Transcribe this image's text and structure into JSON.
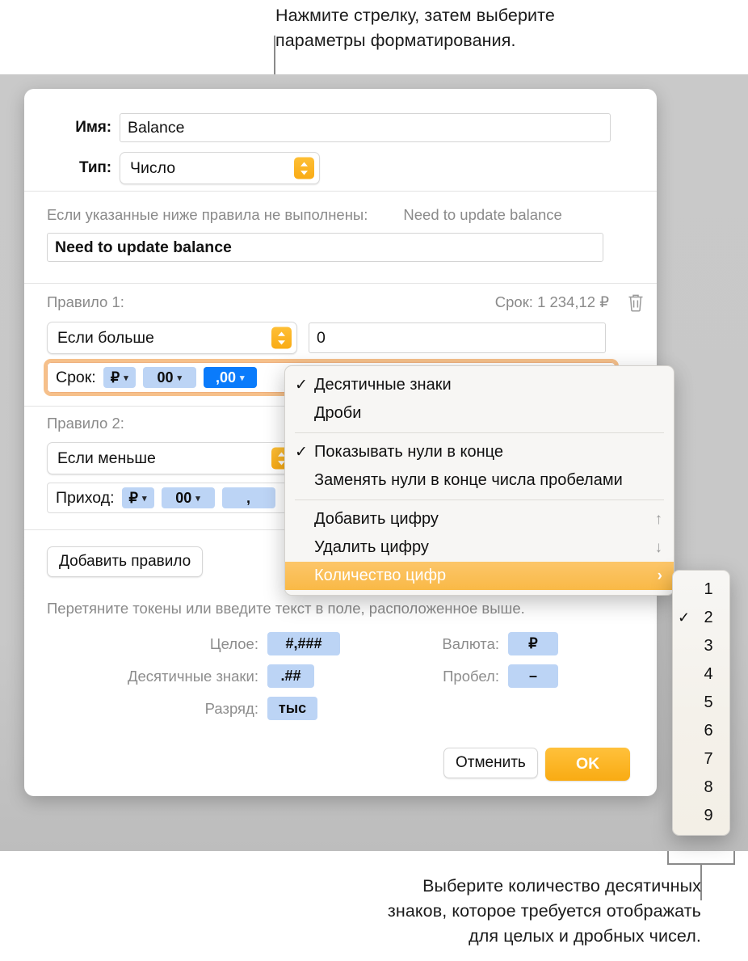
{
  "captions": {
    "top": "Нажмите стрелку, затем выберите\nпараметры форматирования.",
    "bottom": "Выберите количество десятичных\nзнаков, которое требуется отображать\nдля целых и дробных чисел."
  },
  "dialog": {
    "name_label": "Имя:",
    "name_value": "Balance",
    "type_label": "Тип:",
    "type_value": "Число",
    "fallback_label": "Если указанные ниже правила не выполнены:",
    "fallback_preview": "Need to update balance",
    "fallback_value": "Need to update balance",
    "rules": [
      {
        "title": "Правило 1:",
        "preview": "Срок: 1 234,12 ₽",
        "condition": "Если больше",
        "condition_value": "0",
        "format_prefix": "Срок:",
        "tokens": [
          {
            "text": "₽",
            "caret": true,
            "selected": false
          },
          {
            "text": "00",
            "caret": true,
            "selected": false
          },
          {
            "text": ",00",
            "caret": true,
            "selected": true
          }
        ]
      },
      {
        "title": "Правило 2:",
        "condition": "Если меньше",
        "format_prefix": "Приход:",
        "tokens": [
          {
            "text": "₽",
            "caret": true,
            "selected": false
          },
          {
            "text": "00",
            "caret": true,
            "selected": false
          },
          {
            "text": ",",
            "caret": false,
            "selected": false
          }
        ]
      }
    ],
    "add_rule_label": "Добавить правило",
    "hint": "Перетяните токены или введите текст в поле, расположенное выше.",
    "palette": [
      {
        "label": "Целое:",
        "token": "#,###",
        "col": "left"
      },
      {
        "label": "Десятичные знаки:",
        "token": ".##",
        "col": "left"
      },
      {
        "label": "Разряд:",
        "token": "тыс",
        "col": "left"
      },
      {
        "label": "Валюта:",
        "token": "₽",
        "col": "right"
      },
      {
        "label": "Пробел:",
        "token": "–",
        "col": "right"
      }
    ],
    "cancel_label": "Отменить",
    "ok_label": "OK"
  },
  "menu": {
    "items": [
      {
        "label": "Десятичные знаки",
        "checked": true,
        "trail": "",
        "highlight": false,
        "divider_after": false
      },
      {
        "label": "Дроби",
        "checked": false,
        "trail": "",
        "highlight": false,
        "divider_after": true
      },
      {
        "label": "Показывать нули в конце",
        "checked": true,
        "trail": "",
        "highlight": false,
        "divider_after": false
      },
      {
        "label": "Заменять нули в конце числа пробелами",
        "checked": false,
        "trail": "",
        "highlight": false,
        "divider_after": true
      },
      {
        "label": "Добавить цифру",
        "checked": false,
        "trail": "↑",
        "highlight": false,
        "divider_after": false
      },
      {
        "label": "Удалить цифру",
        "checked": false,
        "trail": "↓",
        "highlight": false,
        "divider_after": false
      },
      {
        "label": "Количество цифр",
        "checked": false,
        "trail": "›",
        "highlight": true,
        "divider_after": false
      }
    ]
  },
  "submenu": {
    "items": [
      {
        "num": "1",
        "checked": false
      },
      {
        "num": "2",
        "checked": true
      },
      {
        "num": "3",
        "checked": false
      },
      {
        "num": "4",
        "checked": false
      },
      {
        "num": "5",
        "checked": false
      },
      {
        "num": "6",
        "checked": false
      },
      {
        "num": "7",
        "checked": false
      },
      {
        "num": "8",
        "checked": false
      },
      {
        "num": "9",
        "checked": false
      }
    ]
  },
  "colors": {
    "accent_orange": "#f9ab15",
    "selection_blue": "#0a7bfb",
    "token_blue": "#bcd4f5",
    "highlight_amber": "#f9b946",
    "focus_ring": "#efb07c"
  }
}
